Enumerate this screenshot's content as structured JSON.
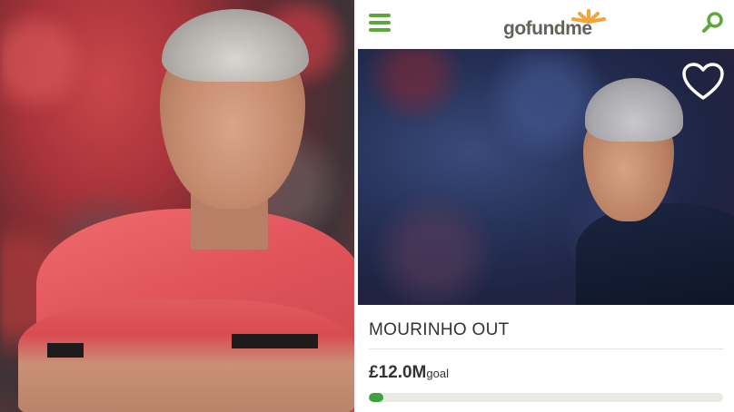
{
  "app": {
    "logo_text_prefix": "gofund",
    "logo_text_suffix": "me",
    "brand_color": "#5aa93a"
  },
  "header": {
    "menu_icon": "hamburger-menu-icon",
    "search_icon": "search-icon"
  },
  "campaign": {
    "title": "MOURINHO OUT",
    "goal_amount": "£12.0M",
    "goal_label": "goal",
    "progress_fraction": 0.04,
    "favorite_icon": "heart-outline-icon"
  }
}
